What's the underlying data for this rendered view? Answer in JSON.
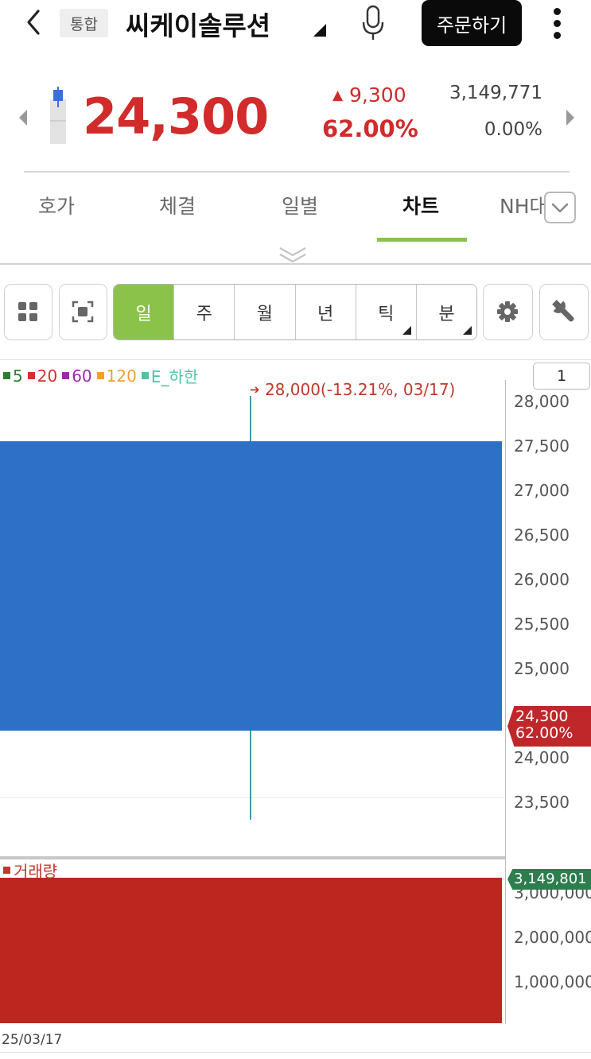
{
  "header": {
    "badge": "통합",
    "stock_name": "씨케이솔루션",
    "order_button": "주문하기"
  },
  "quote": {
    "price": "24,300",
    "change_amount": "9,300",
    "change_percent": "62.00%",
    "volume": "3,149,771",
    "volume_ratio": "0.00%",
    "up_color": "#d12b2b"
  },
  "tabs": [
    {
      "label": "호가"
    },
    {
      "label": "체결"
    },
    {
      "label": "일별"
    },
    {
      "label": "차트",
      "active": true
    },
    {
      "label": "NH대"
    }
  ],
  "periods": [
    {
      "label": "일",
      "active": true
    },
    {
      "label": "주"
    },
    {
      "label": "월"
    },
    {
      "label": "년"
    },
    {
      "label": "틱",
      "has_menu": true
    },
    {
      "label": "분",
      "has_menu": true
    }
  ],
  "chart": {
    "legend": [
      {
        "label": "5",
        "color": "#2e7d32"
      },
      {
        "label": "20",
        "color": "#d32f2f"
      },
      {
        "label": "60",
        "color": "#9c27b0"
      },
      {
        "label": "120",
        "color": "#f0a030"
      },
      {
        "label": "E_하한",
        "color": "#4fc3a1"
      }
    ],
    "page_number": "1",
    "annotation": "28,000(-13.21%, 03/17)",
    "price_axis_ticks": [
      "28,000",
      "27,500",
      "27,000",
      "26,500",
      "26,000",
      "25,500",
      "25,000",
      "24,000",
      "23,500"
    ],
    "current_price_tag": {
      "price": "24,300",
      "percent": "62.00%"
    },
    "volume_legend": "거래량",
    "volume_tag": "3,149,801",
    "volume_axis_ticks": [
      "3,000,000",
      "2,000,000",
      "1,000,000"
    ],
    "date_label": "25/03/17"
  },
  "chart_data": {
    "type": "candlestick",
    "x": [
      "25/03/17"
    ],
    "candles": [
      {
        "date": "25/03/17",
        "open": 24300,
        "close": 27550,
        "high": 28000,
        "low": 23300
      }
    ],
    "volume": [
      3149801
    ],
    "price_ticks": [
      28000,
      27500,
      27000,
      26500,
      26000,
      25500,
      25000,
      24000,
      23500
    ],
    "volume_ticks": [
      3000000,
      2000000,
      1000000
    ],
    "candle_color": "#2e6fc7",
    "volume_color": "#bd261f"
  }
}
